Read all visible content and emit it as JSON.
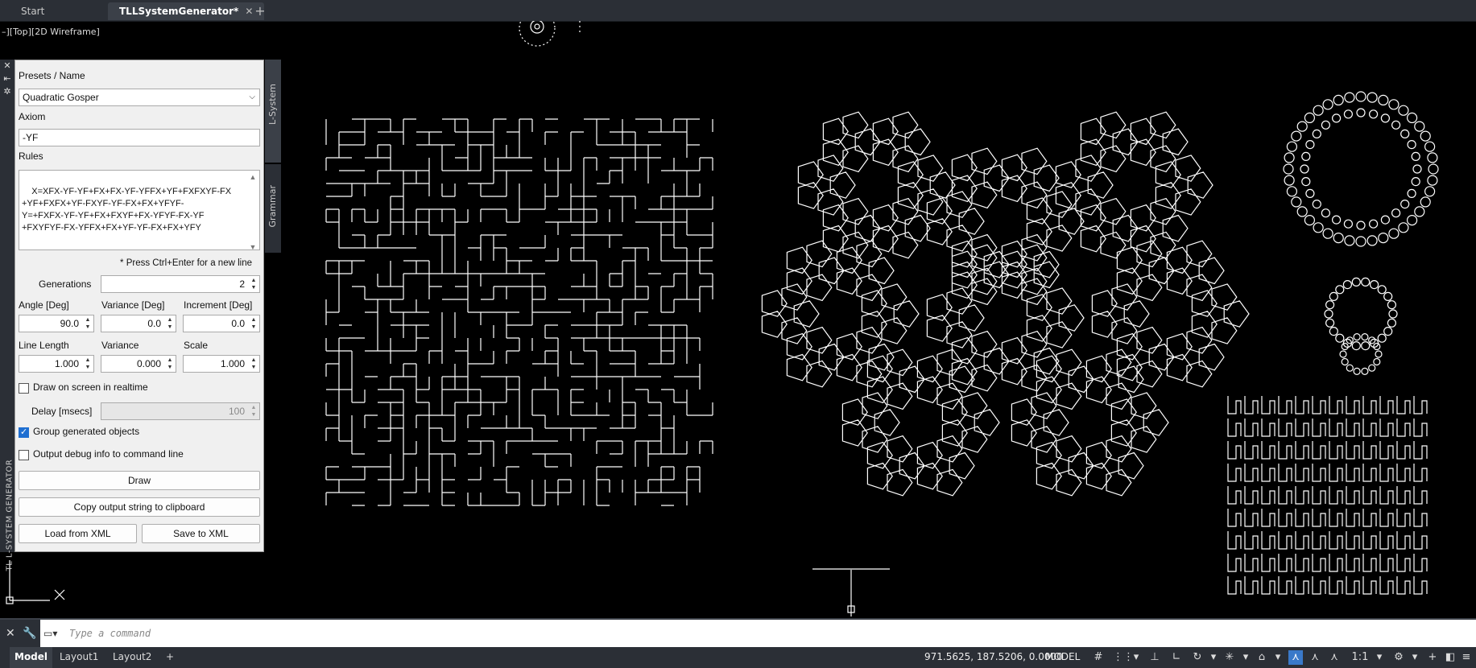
{
  "tabs": [
    {
      "label": "Start",
      "active": false
    },
    {
      "label": "TLLSystemGenerator*",
      "active": true
    }
  ],
  "viewport_label": "–][Top][2D Wireframe]",
  "panel": {
    "strip_title": "TL L-SYSTEM GENERATOR",
    "side_tabs": [
      "L-System",
      "Grammar"
    ],
    "presets_label": "Presets / Name",
    "preset_value": "Quadratic Gosper",
    "axiom_label": "Axiom",
    "axiom_value": "-YF",
    "rules_label": "Rules",
    "rules_value": "X=XFX-YF-YF+FX+FX-YF-YFFX+YF+FXFXYF-FX\n+YF+FXFX+YF-FXYF-YF-FX+FX+YFYF-\nY=+FXFX-YF-YF+FX+FXYF+FX-YFYF-FX-YF\n+FXYFYF-FX-YFFX+FX+YF-YF-FX+FX+YFY",
    "hint": "* Press Ctrl+Enter for a new line",
    "generations_label": "Generations",
    "generations_value": "2",
    "angle_label": "Angle [Deg]",
    "angle_value": "90.0",
    "variance_deg_label": "Variance [Deg]",
    "variance_deg_value": "0.0",
    "increment_label": "Increment [Deg]",
    "increment_value": "0.0",
    "line_length_label": "Line Length",
    "line_length_value": "1.000",
    "variance_label": "Variance",
    "variance_value": "0.000",
    "scale_label": "Scale",
    "scale_value": "1.000",
    "realtime_label": "Draw on screen in realtime",
    "realtime_checked": false,
    "delay_label": "Delay [msecs]",
    "delay_value": "100",
    "group_label": "Group generated objects",
    "group_checked": true,
    "debug_label": "Output debug info to command line",
    "debug_checked": false,
    "draw_button": "Draw",
    "copy_button": "Copy output string to clipboard",
    "load_button": "Load from XML",
    "save_button": "Save to XML"
  },
  "command": {
    "placeholder": "Type a command"
  },
  "status": {
    "layout_tabs": [
      "Model",
      "Layout1",
      "Layout2"
    ],
    "coordinates": "971.5625, 187.5206, 0.0000",
    "space": "MODEL",
    "scale": "1:1"
  },
  "colors": {
    "canvas": "#000000",
    "linework": "#ffffff",
    "chrome": "#2b2f36",
    "accent": "#1f6fd1"
  }
}
